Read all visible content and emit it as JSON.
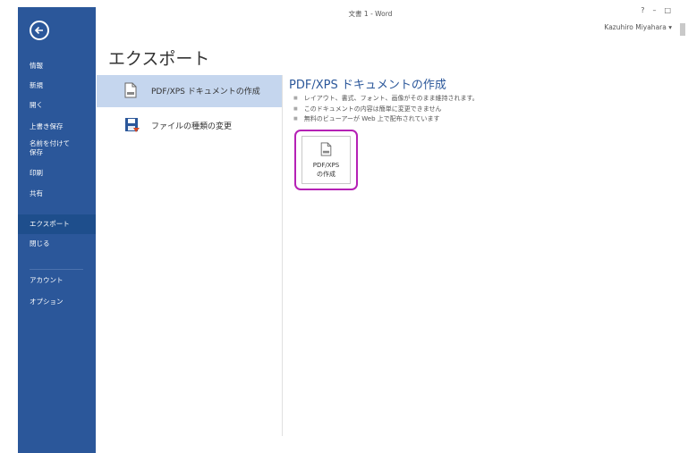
{
  "window": {
    "title": "文書 1 - Word",
    "controls": [
      "?",
      "–",
      "□"
    ],
    "user": "Kazuhiro Miyahara ▾"
  },
  "sidebar": {
    "items": [
      {
        "label": "情報"
      },
      {
        "label": "新規"
      },
      {
        "label": "開く"
      },
      {
        "label": "上書き保存"
      },
      {
        "label": "名前を付けて 保存"
      },
      {
        "label": "印刷"
      },
      {
        "label": "共有"
      },
      {
        "label": "エクスポート",
        "active": true
      },
      {
        "label": "閉じる"
      },
      {
        "label": "アカウント"
      },
      {
        "label": "オプション"
      }
    ]
  },
  "main": {
    "title": "エクスポート",
    "options": [
      {
        "label": "PDF/XPS ドキュメントの作成",
        "icon": "pdf-document-icon",
        "selected": true
      },
      {
        "label": "ファイルの種類の変更",
        "icon": "change-file-type-icon",
        "selected": false
      }
    ]
  },
  "panel": {
    "title": "PDF/XPS ドキュメントの作成",
    "bullets": [
      "レイアウト、書式、フォント、画像がそのまま維持されます。",
      "このドキュメントの内容は簡単に変更できません",
      "無料のビューアーが Web 上で配布されています"
    ],
    "button": {
      "line1": "PDF/XPS",
      "line2": "の作成",
      "icon": "pdf-document-icon"
    }
  },
  "colors": {
    "sidebar": "#2b579a",
    "selected": "#c5d6ee",
    "highlight": "#b521b5"
  }
}
